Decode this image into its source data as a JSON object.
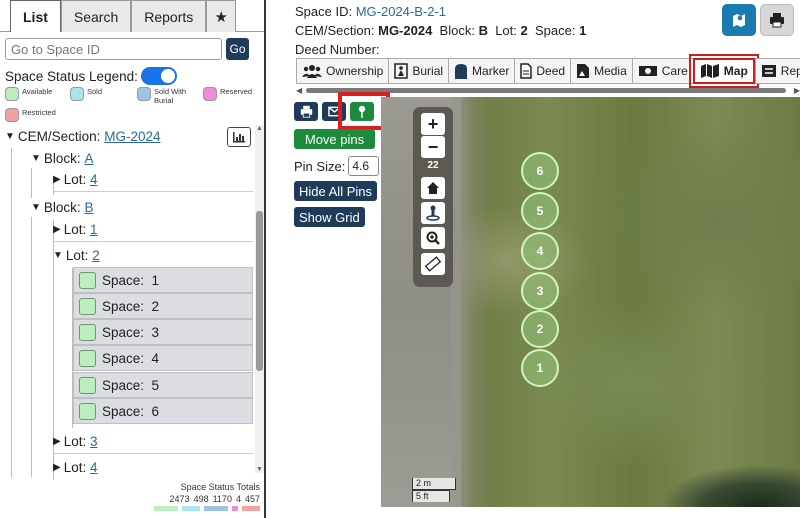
{
  "left_panel": {
    "tabs": [
      {
        "label": "List",
        "active": true
      },
      {
        "label": "Search",
        "active": false
      },
      {
        "label": "Reports",
        "active": false
      },
      {
        "label": "★",
        "active": false
      }
    ],
    "goto": {
      "placeholder": "Go to Space ID",
      "button_label": "Go"
    },
    "legend": {
      "title": "Space Status Legend:",
      "toggle_on": true,
      "items": [
        {
          "label": "Available",
          "color": "#bdeec0"
        },
        {
          "label": "Sold",
          "color": "#a8e6ec"
        },
        {
          "label": "Sold With Burial",
          "color": "#9fc2ea"
        },
        {
          "label": "Reserved",
          "color": "#f28ad8"
        },
        {
          "label": "Restricted",
          "color": "#f2a0a0"
        }
      ]
    },
    "tree": {
      "section_prefix": "CEM/Section:",
      "section_link": "MG-2024",
      "block_prefix": "Block:",
      "lot_prefix": "Lot:",
      "space_prefix": "Space:",
      "block_a": {
        "name": "A",
        "lot": "4"
      },
      "block_b": {
        "name": "B",
        "lots": [
          "1",
          "2",
          "3",
          "4"
        ],
        "spaces": [
          "1",
          "2",
          "3",
          "4",
          "5",
          "6"
        ]
      }
    },
    "totals": {
      "title": "Space Status Totals",
      "values": [
        "2473",
        "498",
        "1170",
        "4",
        "457"
      ],
      "colors": [
        "#bdeec0",
        "#a8e6ec",
        "#9fc2ea",
        "#f28ad8",
        "#f2a0a0"
      ]
    }
  },
  "right_panel": {
    "space_id_label": "Space ID:",
    "space_id": "MG-2024-B-2-1",
    "section_label": "CEM/Section:",
    "section": "MG-2024",
    "block_label": "Block:",
    "block": "B",
    "lot_label": "Lot:",
    "lot": "2",
    "space_label": "Space:",
    "space": "1",
    "deed_label": "Deed Number:",
    "tabs": [
      {
        "label": "Ownership",
        "icon": "people-icon"
      },
      {
        "label": "Burial",
        "icon": "burial-icon"
      },
      {
        "label": "Marker",
        "icon": "headstone-icon"
      },
      {
        "label": "Deed",
        "icon": "document-icon"
      },
      {
        "label": "Media",
        "icon": "media-icon"
      },
      {
        "label": "Care",
        "icon": "money-icon"
      },
      {
        "label": "Map",
        "icon": "map-icon",
        "active": true
      },
      {
        "label": "Rep",
        "icon": "list-icon"
      }
    ],
    "map_tools": {
      "move_pins": "Move pins",
      "pin_size_label": "Pin Size:",
      "pin_size_value": "4.6",
      "hide_all_pins": "Hide All Pins",
      "show_grid": "Show Grid"
    },
    "map": {
      "zoom_level": "22",
      "pins": [
        "6",
        "5",
        "4",
        "3",
        "2",
        "1"
      ],
      "scale_metric": "2 m",
      "scale_imperial": "5 ft"
    },
    "colors": {
      "navy": "#1f3b5a",
      "green": "#1e8a3c",
      "teal": "#1a7bb0",
      "highlight": "#d81e1e"
    }
  }
}
